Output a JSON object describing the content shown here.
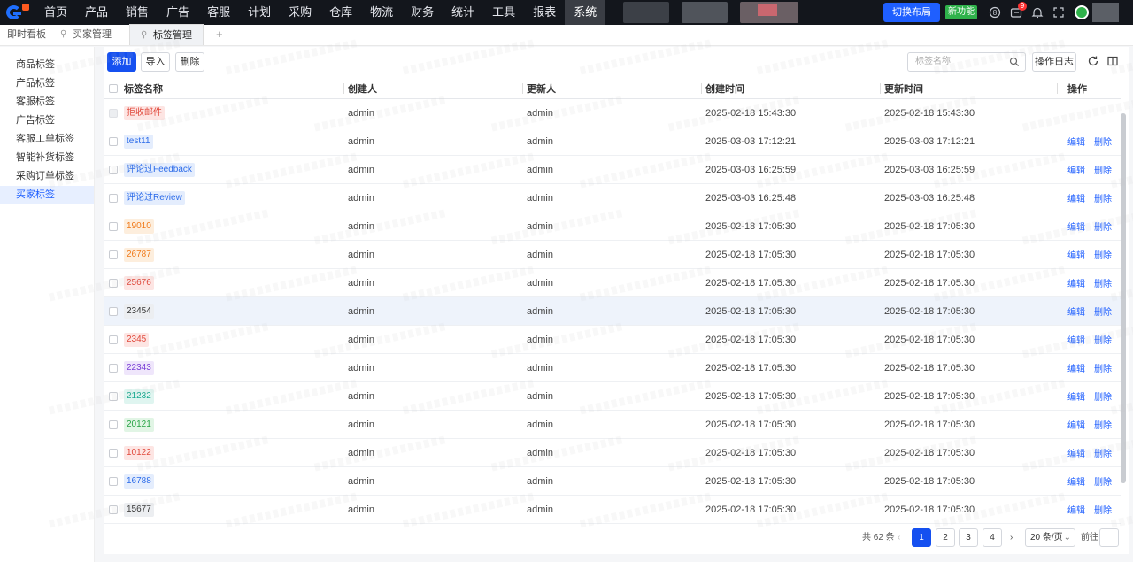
{
  "nav": {
    "items": [
      "首页",
      "产品",
      "销售",
      "广告",
      "客服",
      "计划",
      "采购",
      "仓库",
      "物流",
      "财务",
      "统计",
      "工具",
      "报表",
      "系统"
    ],
    "active_index": 13
  },
  "header": {
    "switch_layout": "切换布局",
    "new_feature": "新功能",
    "message_count": "9"
  },
  "tabs": {
    "items": [
      "即时看板",
      "买家管理",
      "标签管理"
    ],
    "active_index": 2
  },
  "sidebar": {
    "items": [
      "商品标签",
      "产品标签",
      "客服标签",
      "广告标签",
      "客服工单标签",
      "智能补货标签",
      "采购订单标签",
      "买家标签"
    ],
    "active_index": 7
  },
  "toolbar": {
    "add": "添加",
    "import": "导入",
    "delete": "删除",
    "search_placeholder": "标签名称",
    "operation_log": "操作日志"
  },
  "table": {
    "columns": [
      "标签名称",
      "创建人",
      "更新人",
      "创建时间",
      "更新时间",
      "操作"
    ],
    "edit_label": "编辑",
    "delete_label": "删除",
    "rows": [
      {
        "name": "拒收邮件",
        "color": "#e0483b",
        "bg": "#fde5e3",
        "creator": "admin",
        "updater": "admin",
        "created": "2025-02-18 15:43:30",
        "updated": "2025-02-18 15:43:30",
        "ops": false
      },
      {
        "name": "test11",
        "color": "#2a6ae9",
        "bg": "#e4edfd",
        "creator": "admin",
        "updater": "admin",
        "created": "2025-03-03 17:12:21",
        "updated": "2025-03-03 17:12:21",
        "ops": true
      },
      {
        "name": "评论过Feedback",
        "color": "#2a6ae9",
        "bg": "#e4edfd",
        "creator": "admin",
        "updater": "admin",
        "created": "2025-03-03 16:25:59",
        "updated": "2025-03-03 16:25:59",
        "ops": true
      },
      {
        "name": "评论过Review",
        "color": "#2a6ae9",
        "bg": "#e4edfd",
        "creator": "admin",
        "updater": "admin",
        "created": "2025-03-03 16:25:48",
        "updated": "2025-03-03 16:25:48",
        "ops": true
      },
      {
        "name": "19010",
        "color": "#f07a1a",
        "bg": "#fdeedd",
        "creator": "admin",
        "updater": "admin",
        "created": "2025-02-18 17:05:30",
        "updated": "2025-02-18 17:05:30",
        "ops": true
      },
      {
        "name": "26787",
        "color": "#f07a1a",
        "bg": "#fdeedd",
        "creator": "admin",
        "updater": "admin",
        "created": "2025-02-18 17:05:30",
        "updated": "2025-02-18 17:05:30",
        "ops": true
      },
      {
        "name": "25676",
        "color": "#e0483b",
        "bg": "#fde5e3",
        "creator": "admin",
        "updater": "admin",
        "created": "2025-02-18 17:05:30",
        "updated": "2025-02-18 17:05:30",
        "ops": true
      },
      {
        "name": "23454",
        "color": "#333333",
        "bg": "#eceef1",
        "creator": "admin",
        "updater": "admin",
        "created": "2025-02-18 17:05:30",
        "updated": "2025-02-18 17:05:30",
        "ops": true
      },
      {
        "name": "2345",
        "color": "#e0483b",
        "bg": "#fde5e3",
        "creator": "admin",
        "updater": "admin",
        "created": "2025-02-18 17:05:30",
        "updated": "2025-02-18 17:05:30",
        "ops": true
      },
      {
        "name": "22343",
        "color": "#7a3fd6",
        "bg": "#efe6fb",
        "creator": "admin",
        "updater": "admin",
        "created": "2025-02-18 17:05:30",
        "updated": "2025-02-18 17:05:30",
        "ops": true
      },
      {
        "name": "21232",
        "color": "#17a88f",
        "bg": "#dff5f0",
        "creator": "admin",
        "updater": "admin",
        "created": "2025-02-18 17:05:30",
        "updated": "2025-02-18 17:05:30",
        "ops": true
      },
      {
        "name": "20121",
        "color": "#27a345",
        "bg": "#e1f5e5",
        "creator": "admin",
        "updater": "admin",
        "created": "2025-02-18 17:05:30",
        "updated": "2025-02-18 17:05:30",
        "ops": true
      },
      {
        "name": "10122",
        "color": "#e0483b",
        "bg": "#fde5e3",
        "creator": "admin",
        "updater": "admin",
        "created": "2025-02-18 17:05:30",
        "updated": "2025-02-18 17:05:30",
        "ops": true
      },
      {
        "name": "16788",
        "color": "#2a6ae9",
        "bg": "#e4edfd",
        "creator": "admin",
        "updater": "admin",
        "created": "2025-02-18 17:05:30",
        "updated": "2025-02-18 17:05:30",
        "ops": true
      },
      {
        "name": "15677",
        "color": "#333333",
        "bg": "#eceef1",
        "creator": "admin",
        "updater": "admin",
        "created": "2025-02-18 17:05:30",
        "updated": "2025-02-18 17:05:30",
        "ops": true
      }
    ],
    "highlighted_row": 7
  },
  "pagination": {
    "total": "共 62 条",
    "pages": [
      "1",
      "2",
      "3",
      "4"
    ],
    "current": "1",
    "page_size": "20 条/页",
    "goto": "前往"
  },
  "colors": {
    "topbar": "#13161c",
    "primary": "#1550f0",
    "new_badge": "#2fb24b"
  }
}
